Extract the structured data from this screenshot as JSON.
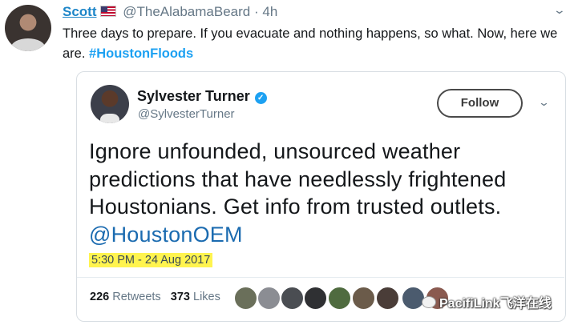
{
  "tweet": {
    "author_name": "Scott",
    "author_handle": "@TheAlabamaBeard",
    "separator": "·",
    "time": "4h",
    "text": "Three days to prepare. If you evacuate and nothing happens, so what. Now, here we are.",
    "hashtag": "#HoustonFloods"
  },
  "quoted": {
    "name": "Sylvester Turner",
    "handle": "@SylvesterTurner",
    "follow_label": "Follow",
    "text": "Ignore unfounded, unsourced weather predictions that have needlessly frightened Houstonians. Get info from trusted outlets.",
    "mention": "@HoustonOEM",
    "timestamp": "5:30 PM - 24 Aug 2017",
    "retweets": "226",
    "retweets_label": "Retweets",
    "likes": "373",
    "likes_label": "Likes"
  },
  "watermark": "PacifiLink飞洋在线",
  "icons": {
    "more_menu": "chevron-down-icon",
    "verified": "verified-badge-icon",
    "flag": "us-flag-icon"
  },
  "colors": {
    "link": "#1da1f2",
    "name_link": "#1e86c8",
    "highlight": "#fff44f"
  }
}
